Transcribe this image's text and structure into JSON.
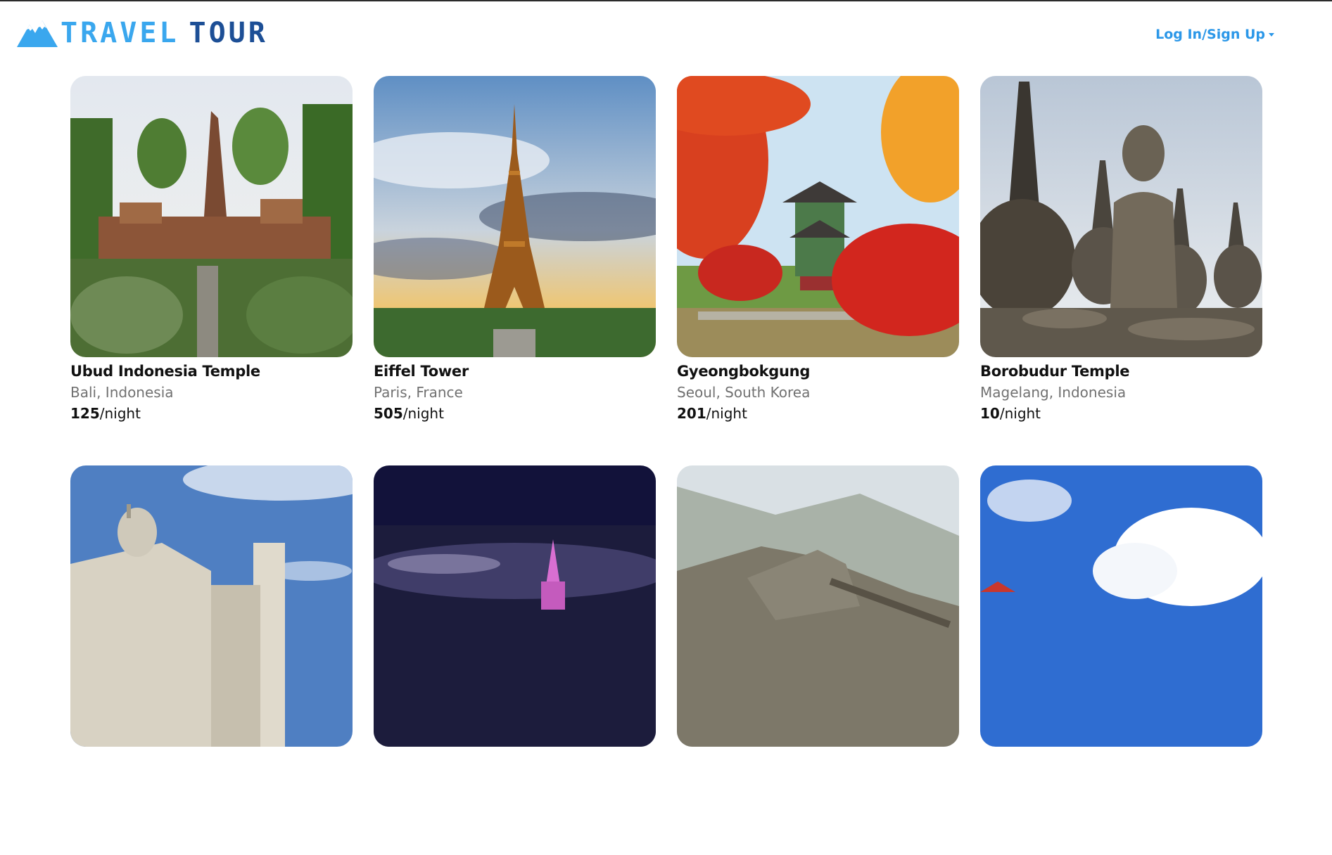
{
  "header": {
    "logo_word1": "TRAVEL",
    "logo_word2": "TOUR",
    "login_label": "Log In/Sign Up"
  },
  "listings": [
    {
      "title": "Ubud Indonesia Temple",
      "location": "Bali, Indonesia",
      "price": "125",
      "unit": "/night"
    },
    {
      "title": "Eiffel Tower",
      "location": "Paris, France",
      "price": "505",
      "unit": "/night"
    },
    {
      "title": "Gyeongbokgung",
      "location": "Seoul, South Korea",
      "price": "201",
      "unit": "/night"
    },
    {
      "title": "Borobudur Temple",
      "location": "Magelang, Indonesia",
      "price": "10",
      "unit": "/night"
    }
  ],
  "colors": {
    "accent": "#2b97e8",
    "logo_light": "#3aa7ee",
    "logo_dark": "#1d4f96"
  }
}
